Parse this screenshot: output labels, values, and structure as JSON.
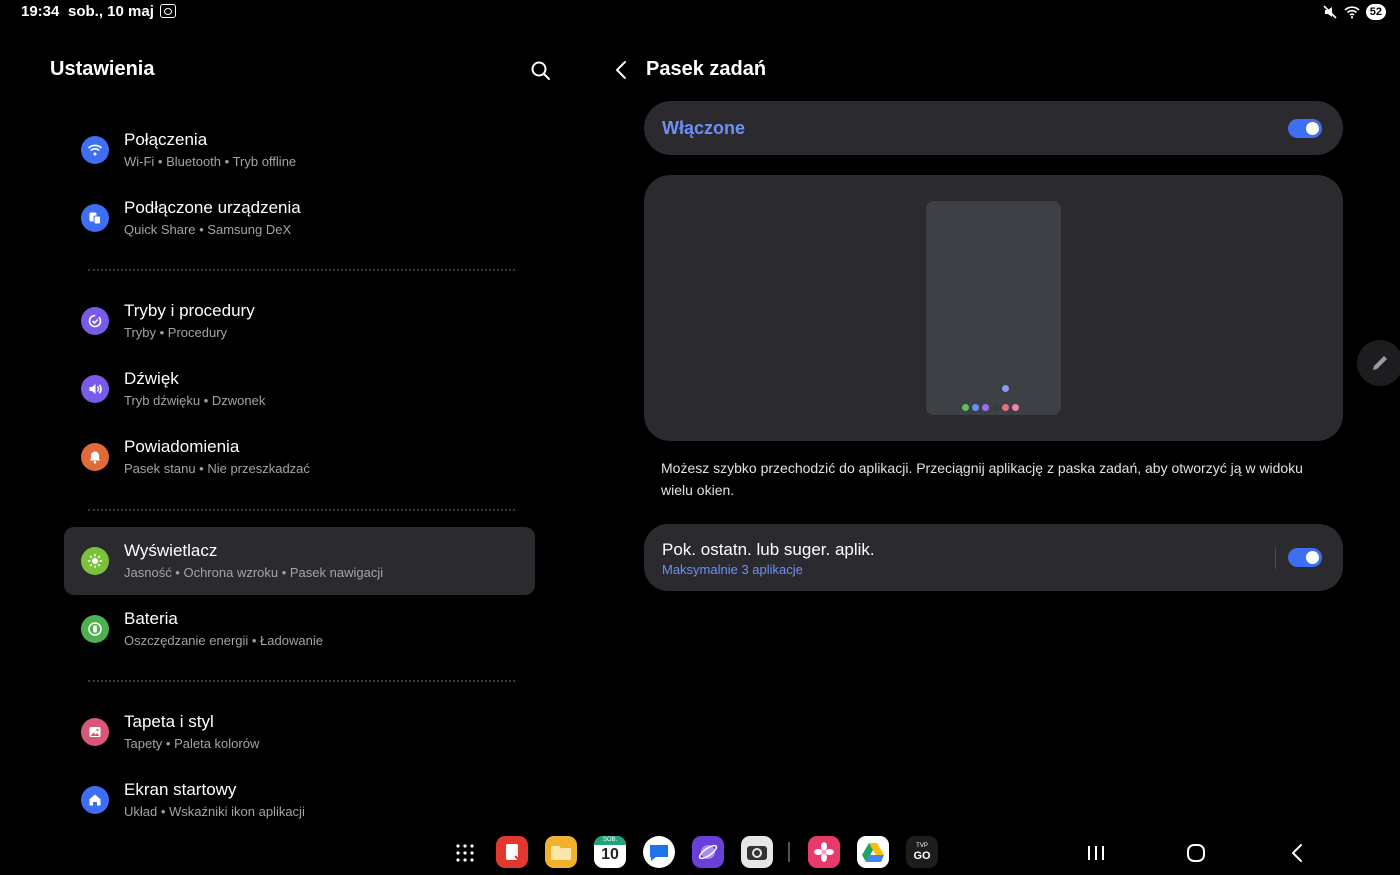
{
  "status_bar": {
    "time": "19:34",
    "date": "sob., 10 maj",
    "battery": "52"
  },
  "left": {
    "title": "Ustawienia",
    "items": [
      {
        "title": "Połączenia",
        "subtitle": "Wi-Fi  •  Bluetooth  •  Tryb offline",
        "icon": "wifi-icon",
        "color": "#3e6ef2"
      },
      {
        "title": "Podłączone urządzenia",
        "subtitle": "Quick Share  •  Samsung DeX",
        "icon": "devices-icon",
        "color": "#3e6ef2"
      },
      {
        "title": "Tryby i procedury",
        "subtitle": "Tryby  •  Procedury",
        "icon": "check-circle-icon",
        "color": "#7a5ae8"
      },
      {
        "title": "Dźwięk",
        "subtitle": "Tryb dźwięku  •  Dzwonek",
        "icon": "speaker-icon",
        "color": "#7a5ae8"
      },
      {
        "title": "Powiadomienia",
        "subtitle": "Pasek stanu  •  Nie przeszkadzać",
        "icon": "bell-icon",
        "color": "#e06a3a"
      },
      {
        "title": "Wyświetlacz",
        "subtitle": "Jasność  •  Ochrona wzroku  •  Pasek nawigacji",
        "icon": "sun-icon",
        "color": "#7cc13a",
        "selected": true
      },
      {
        "title": "Bateria",
        "subtitle": "Oszczędzanie energii  •  Ładowanie",
        "icon": "battery-icon",
        "color": "#4fb04f"
      },
      {
        "title": "Tapeta i styl",
        "subtitle": "Tapety  •  Paleta kolorów",
        "icon": "image-icon",
        "color": "#d9587a"
      },
      {
        "title": "Ekran startowy",
        "subtitle": "Układ  •  Wskaźniki ikon aplikacji",
        "icon": "home-icon",
        "color": "#3e6ef2"
      }
    ]
  },
  "right": {
    "title": "Pasek zadań",
    "master_label": "Włączone",
    "master_on": true,
    "description": "Możesz szybko przechodzić do aplikacji. Przeciągnij aplikację z paska zadań, aby otworzyć ją w widoku wielu okien.",
    "recent_title": "Pok. ostatn. lub suger. aplik.",
    "recent_sub": "Maksymalnie 3 aplikacje",
    "recent_on": true,
    "preview_dot_colors": [
      "#5bbf5b",
      "#6a8ff5",
      "#9a6ff0",
      "#3a3a3e",
      "#e8707a",
      "#e88aa8"
    ]
  },
  "taskbar": {
    "calendar_day_label": "SOB.",
    "calendar_day": "10",
    "tvp_label": "TVP",
    "tvp_go": "GO",
    "apps": [
      "apps-grid-icon",
      "notes-app-icon",
      "files-app-icon",
      "calendar-app-icon",
      "messages-app-icon",
      "browser-app-icon",
      "camera-app-icon",
      "gallery-app-icon",
      "drive-app-icon",
      "tvp-go-app-icon"
    ]
  },
  "colors": {
    "accent": "#3e6ef2",
    "accent_text": "#6e8ff8",
    "card": "#2b2b2f",
    "background": "#000000"
  }
}
